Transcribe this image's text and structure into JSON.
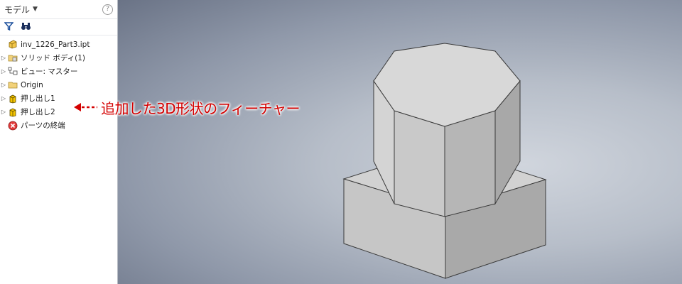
{
  "browser": {
    "title": "モデル",
    "help_glyph": "?",
    "toolbar": {
      "filter_icon": "filter-icon",
      "find_icon": "binoculars-icon"
    },
    "items": [
      {
        "label": "inv_1226_Part3.ipt",
        "icon": "part-icon",
        "expander": ""
      },
      {
        "label": "ソリッド ボディ(1)",
        "icon": "solid-body-folder-icon",
        "expander": "▷"
      },
      {
        "label": "ビュー: マスター",
        "icon": "view-icon",
        "expander": "▷"
      },
      {
        "label": "Origin",
        "icon": "folder-icon",
        "expander": "▷"
      },
      {
        "label": "押し出し1",
        "icon": "extrude-icon",
        "expander": "▷"
      },
      {
        "label": "押し出し2",
        "icon": "extrude-icon",
        "expander": "▷"
      },
      {
        "label": "パーツの終端",
        "icon": "end-of-part-icon",
        "expander": ""
      }
    ]
  },
  "callout": {
    "text": "追加した3D形状のフィーチャー",
    "color": "#d40000"
  },
  "colors": {
    "shape_light": "#d6d6d6",
    "shape_mid": "#c4c4c4",
    "shape_dark": "#a9a9a9",
    "edge": "#3a3a3a",
    "folder": "#f2d27a",
    "extrude": "#f5c400"
  }
}
